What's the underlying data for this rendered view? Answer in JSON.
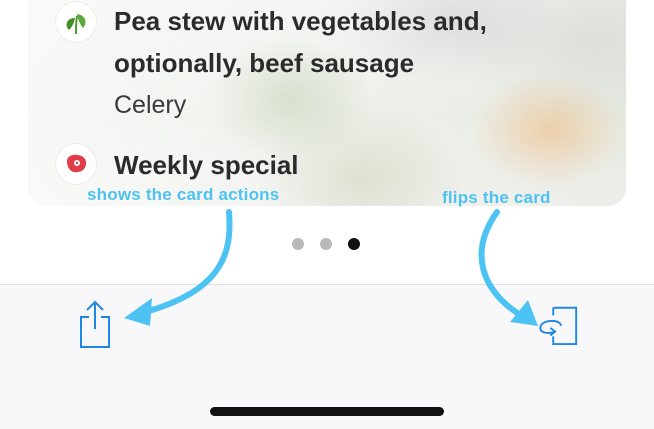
{
  "card": {
    "items": [
      {
        "icon": "leaf-icon",
        "icon_color": "#4f9a2e",
        "title_line1": "Pea stew with vegetables and,",
        "title_line2": "optionally, beef sausage",
        "subtitle": "Celery"
      },
      {
        "icon": "meat-icon",
        "icon_color": "#e23b4a",
        "title_line1": "Weekly special"
      }
    ]
  },
  "annotations": {
    "share_hint": "shows the card actions",
    "flip_hint": "flips the card",
    "color": "#4cc3f2"
  },
  "page_indicator": {
    "count": 3,
    "active_index": 2
  },
  "toolbar": {
    "share_icon": "share-icon",
    "flip_icon": "flip-card-icon",
    "icon_color": "#1e88e5"
  }
}
